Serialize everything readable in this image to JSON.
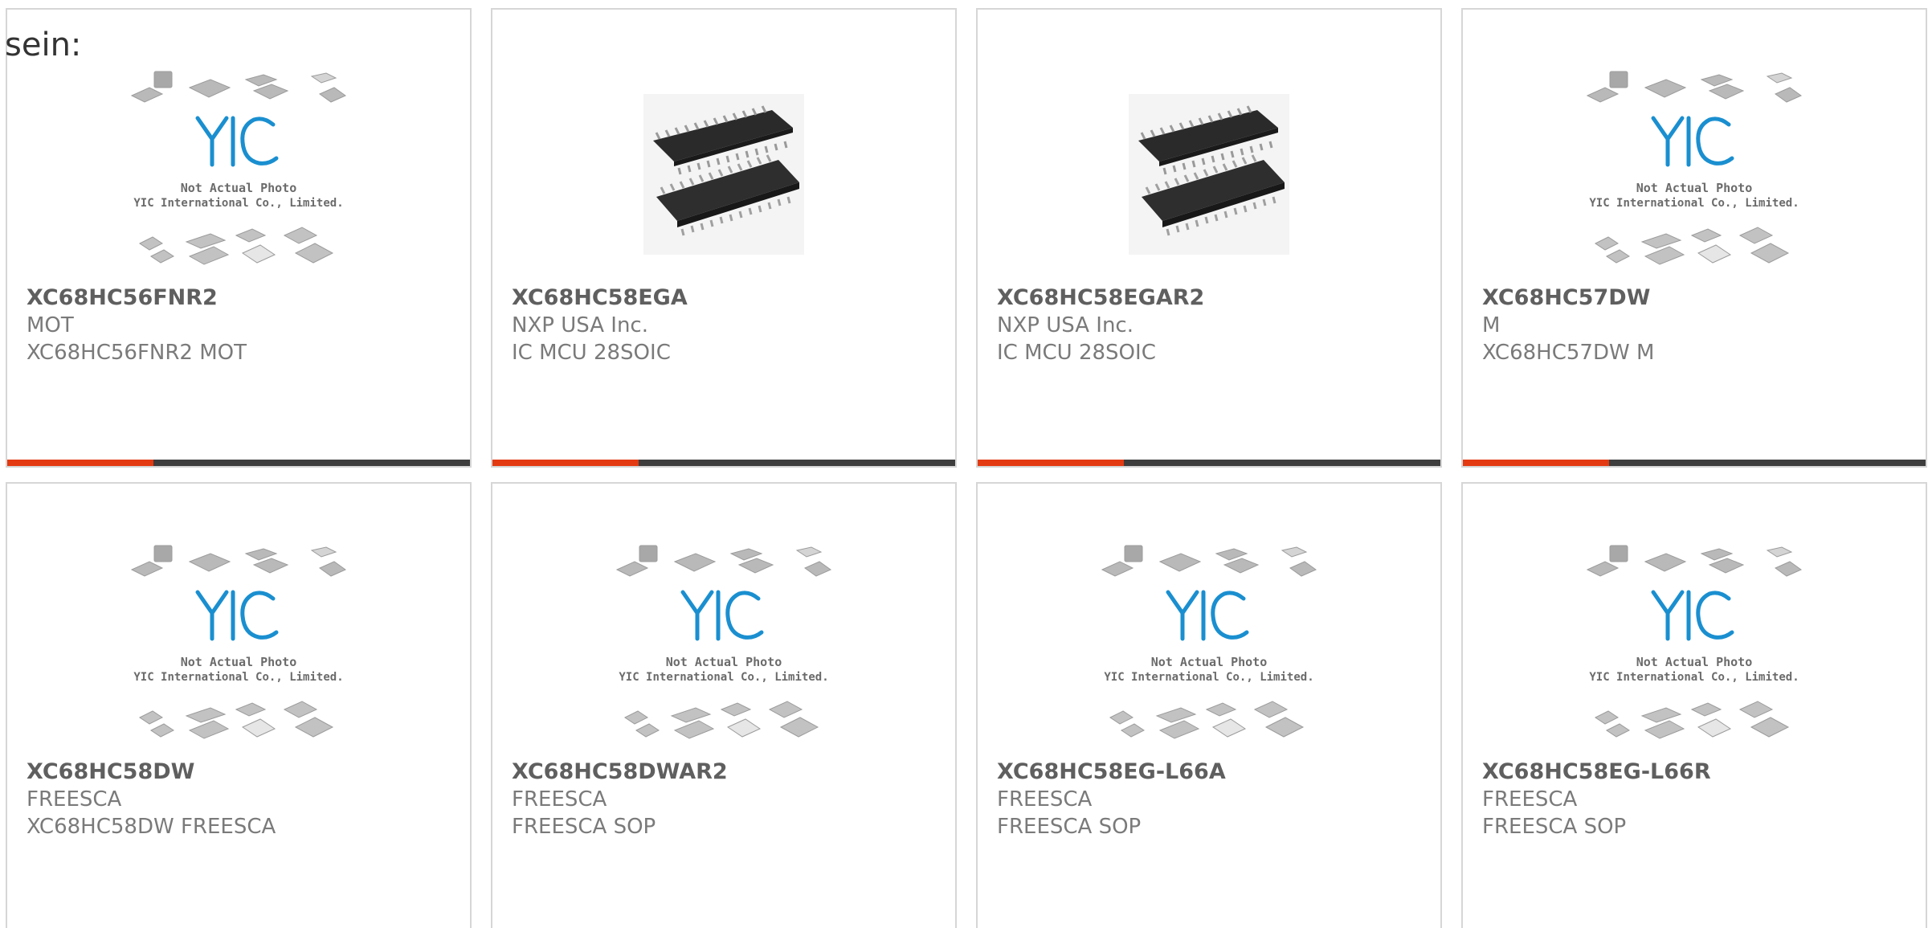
{
  "heading": "sein:",
  "placeholder_image": {
    "line1": "Not Actual Photo",
    "line2": "YIC International Co., Limited.",
    "logo_text": "YIC"
  },
  "colors": {
    "accent": "#e33a12",
    "bar": "#3d3d3d",
    "border": "#d6d6d6",
    "logo_blue": "#1a8fd0"
  },
  "products": [
    {
      "part": "XC68HC56FNR2",
      "manufacturer": "MOT",
      "description": "XC68HC56FNR2 MOT",
      "image": "placeholder-image-icon"
    },
    {
      "part": "XC68HC58EGA",
      "manufacturer": "NXP USA Inc.",
      "description": "IC MCU 28SOIC",
      "image": "soic-chip-icon"
    },
    {
      "part": "XC68HC58EGAR2",
      "manufacturer": "NXP USA Inc.",
      "description": "IC MCU 28SOIC",
      "image": "soic-chip-icon"
    },
    {
      "part": "XC68HC57DW",
      "manufacturer": "M",
      "description": "XC68HC57DW M",
      "image": "placeholder-image-icon"
    },
    {
      "part": "XC68HC58DW",
      "manufacturer": "FREESCA",
      "description": "XC68HC58DW FREESCA",
      "image": "placeholder-image-icon"
    },
    {
      "part": "XC68HC58DWAR2",
      "manufacturer": "FREESCA",
      "description": "FREESCA SOP",
      "image": "placeholder-image-icon"
    },
    {
      "part": "XC68HC58EG-L66A",
      "manufacturer": "FREESCA",
      "description": "FREESCA SOP",
      "image": "placeholder-image-icon"
    },
    {
      "part": "XC68HC58EG-L66R",
      "manufacturer": "FREESCA",
      "description": "FREESCA SOP",
      "image": "placeholder-image-icon"
    }
  ]
}
